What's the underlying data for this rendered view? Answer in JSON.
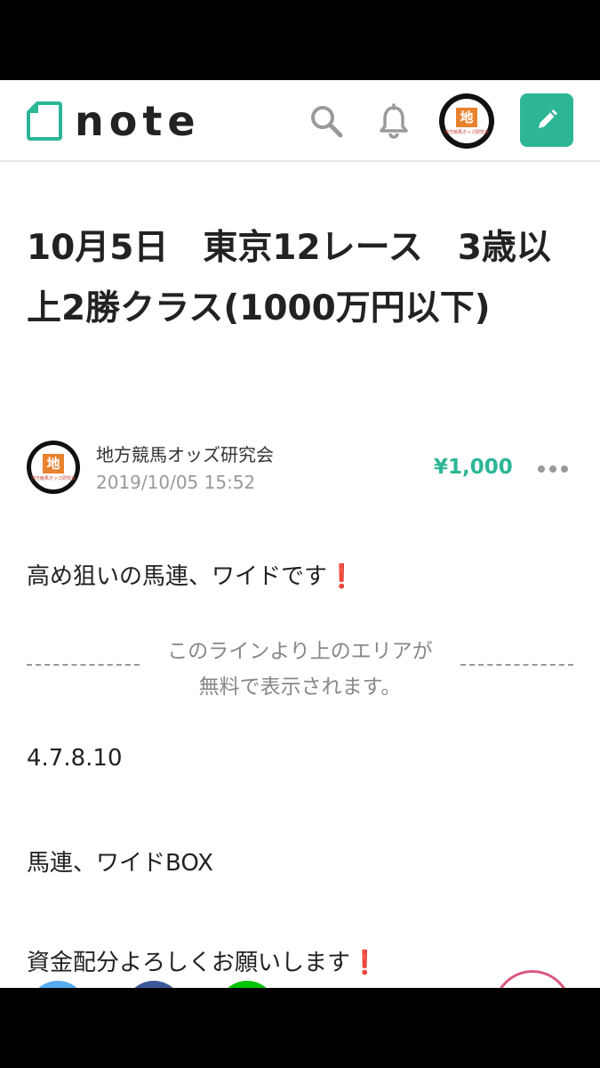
{
  "app": {
    "logo_text": "note",
    "brand_color": "#2cb696"
  },
  "header": {
    "icons": [
      "search-icon",
      "bell-icon",
      "pencil-icon"
    ],
    "avatar_glyph": "地",
    "avatar_caption": "地方競馬オッズ研究会"
  },
  "article": {
    "title": "10月5日　東京12レース　3歳以上2勝クラス(1000万円以下)",
    "author": "地方競馬オッズ研究会",
    "date": "2019/10/05 15:52",
    "price": "¥1,000",
    "paragraphs": {
      "p1": "高め狙いの馬連、ワイドです",
      "p2": "4.7.8.10",
      "p3": "馬連、ワイドBOX",
      "p4": "資金配分よろしくお願いします"
    },
    "exclamation": "❗",
    "paywall_line1": "このラインより上のエリアが",
    "paywall_line2": "無料で表示されます。"
  },
  "colors": {
    "accent": "#2cb696",
    "exclamation": "#e0201b",
    "muted": "#999999"
  }
}
